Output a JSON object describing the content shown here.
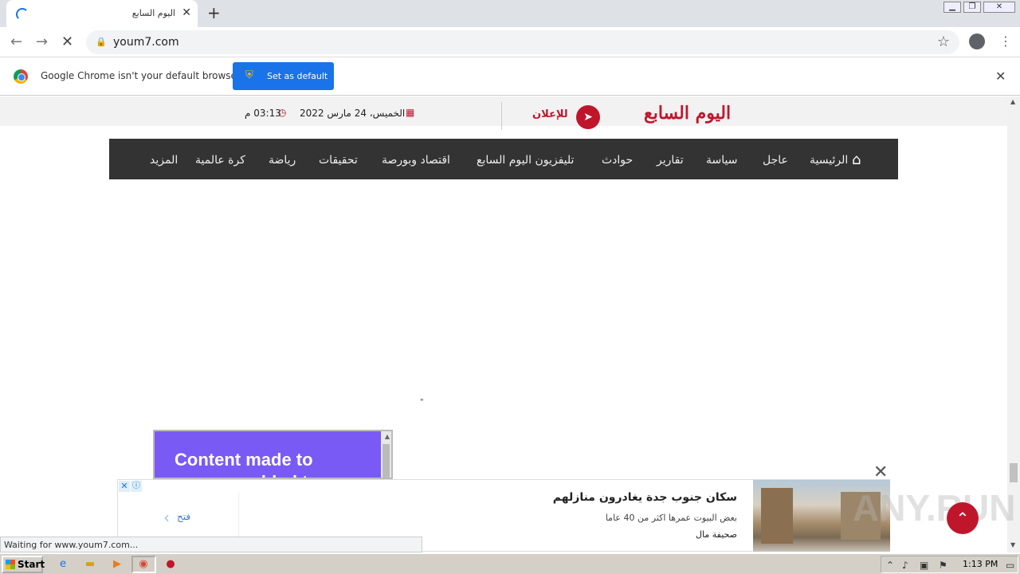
{
  "browser": {
    "tab_title": "اليوم السابع",
    "url": "youm7.com",
    "infobar_message": "Google Chrome isn't your default browser",
    "set_default_label": "Set as default",
    "status_text": "Waiting for www.youm7.com..."
  },
  "site": {
    "logo": "اليوم السابع",
    "ads_label": "للإعلان",
    "date": "الخميس، 24 مارس 2022",
    "time": "03:13 م",
    "nav": [
      {
        "label": "الرئيسية"
      },
      {
        "label": "عاجل"
      },
      {
        "label": "سياسة"
      },
      {
        "label": "تقارير"
      },
      {
        "label": "حوادث"
      },
      {
        "label": "تليفزيون اليوم السابع"
      },
      {
        "label": "اقتصاد وبورصة"
      },
      {
        "label": "تحقيقات"
      },
      {
        "label": "رياضة"
      },
      {
        "label": "كرة عالمية"
      },
      {
        "label": "المزيد"
      }
    ],
    "quote_mark": "\"",
    "ad_box_text": "Content made to engage, added to"
  },
  "bottom_ad": {
    "open_label": "فتح",
    "headline": "سكان جنوب جدة يغادرون منازلهم",
    "subtitle": "بعض البيوت عمرها اكثر من 40 عاما",
    "source": "صحيفة مال"
  },
  "watermark": "ANY.RUN",
  "taskbar": {
    "start_label": "Start",
    "clock": "1:13 PM"
  },
  "colors": {
    "accent": "#c0162c",
    "nav_bg": "#333333",
    "chrome_blue": "#1a73e8"
  }
}
